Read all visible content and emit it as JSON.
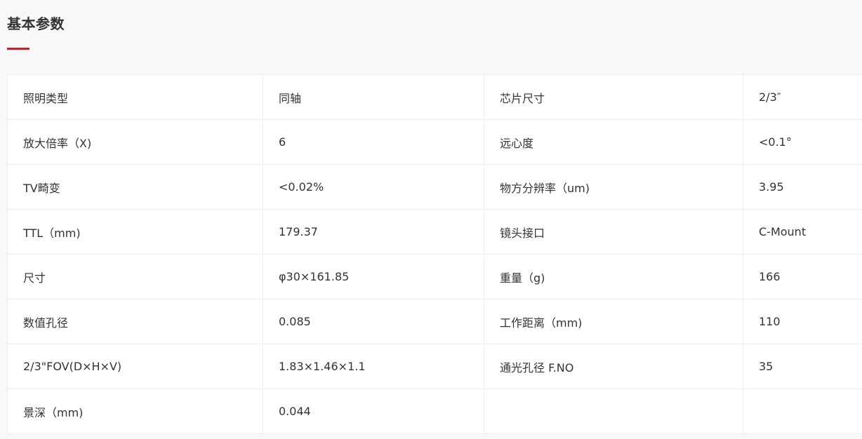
{
  "section": {
    "title": "基本参数",
    "accent_color": "#c0262d"
  },
  "specs": {
    "rows": [
      {
        "label1": "照明类型",
        "value1": "同轴",
        "label2": "芯片尺寸",
        "value2": "2/3″"
      },
      {
        "label1": "放大倍率（X)",
        "value1": "6",
        "label2": "远心度",
        "value2": "<0.1°"
      },
      {
        "label1": "TV畸变",
        "value1": "<0.02%",
        "label2": "物方分辨率（um)",
        "value2": "3.95"
      },
      {
        "label1": "TTL（mm)",
        "value1": "179.37",
        "label2": "镜头接口",
        "value2": "C-Mount"
      },
      {
        "label1": "尺寸",
        "value1": "φ30×161.85",
        "label2": "重量（g)",
        "value2": "166"
      },
      {
        "label1": "数值孔径",
        "value1": "0.085",
        "label2": "工作距离（mm)",
        "value2": "110"
      },
      {
        "label1": "2/3\"FOV(D×H×V)",
        "value1": "1.83×1.46×1.1",
        "label2": "通光孔径 F.NO",
        "value2": "35"
      },
      {
        "label1": "景深（mm)",
        "value1": "0.044",
        "label2": "",
        "value2": ""
      }
    ]
  }
}
